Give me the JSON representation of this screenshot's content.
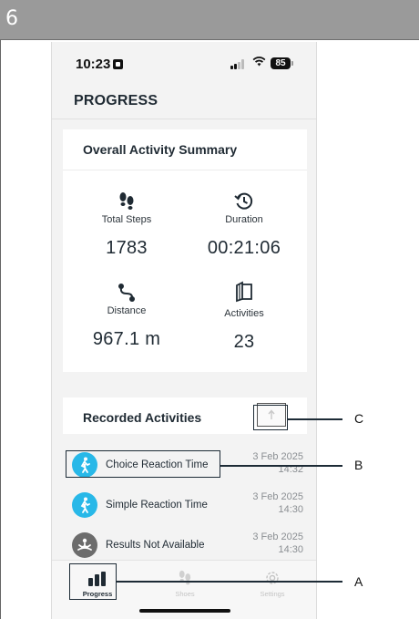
{
  "figure_number": "6",
  "status_bar": {
    "time": "10:23",
    "battery": "85",
    "wifi_icon": "wifi-icon",
    "signal_icon": "cellular-signal-icon"
  },
  "page": {
    "title": "PROGRESS"
  },
  "summary": {
    "title": "Overall Activity Summary",
    "metrics": [
      {
        "icon": "footsteps-icon",
        "label": "Total Steps",
        "value": "1783"
      },
      {
        "icon": "clock-history-icon",
        "label": "Duration",
        "value": "00:21:06"
      },
      {
        "icon": "route-icon",
        "label": "Distance",
        "value": "967.1 m"
      },
      {
        "icon": "layers-icon",
        "label": "Activities",
        "value": "23"
      }
    ]
  },
  "recorded": {
    "title": "Recorded Activities",
    "sort_icon": "arrow-up-icon",
    "items": [
      {
        "name": "Choice Reaction Time",
        "date": "3 Feb 2025",
        "time": "14:32",
        "icon": "walking-person-icon",
        "color": "#28b8e8"
      },
      {
        "name": "Simple Reaction Time",
        "date": "3 Feb 2025",
        "time": "14:30",
        "icon": "walking-person-icon",
        "color": "#28b8e8"
      },
      {
        "name": "Results Not Available",
        "date": "3 Feb 2025",
        "time": "14:30",
        "icon": "meditation-person-icon",
        "color": "#6c6c6c"
      }
    ]
  },
  "tabbar": {
    "tabs": [
      {
        "label": "Progress",
        "icon": "bar-chart-icon",
        "active": true
      },
      {
        "label": "Shoes",
        "icon": "footsteps-icon",
        "active": false
      },
      {
        "label": "Settings",
        "icon": "gear-icon",
        "active": false
      }
    ]
  },
  "callouts": {
    "a": "A",
    "b": "B",
    "c": "C"
  },
  "colors": {
    "accent": "#28b8e8",
    "text": "#1f2a33",
    "muted": "#8b8f93"
  }
}
